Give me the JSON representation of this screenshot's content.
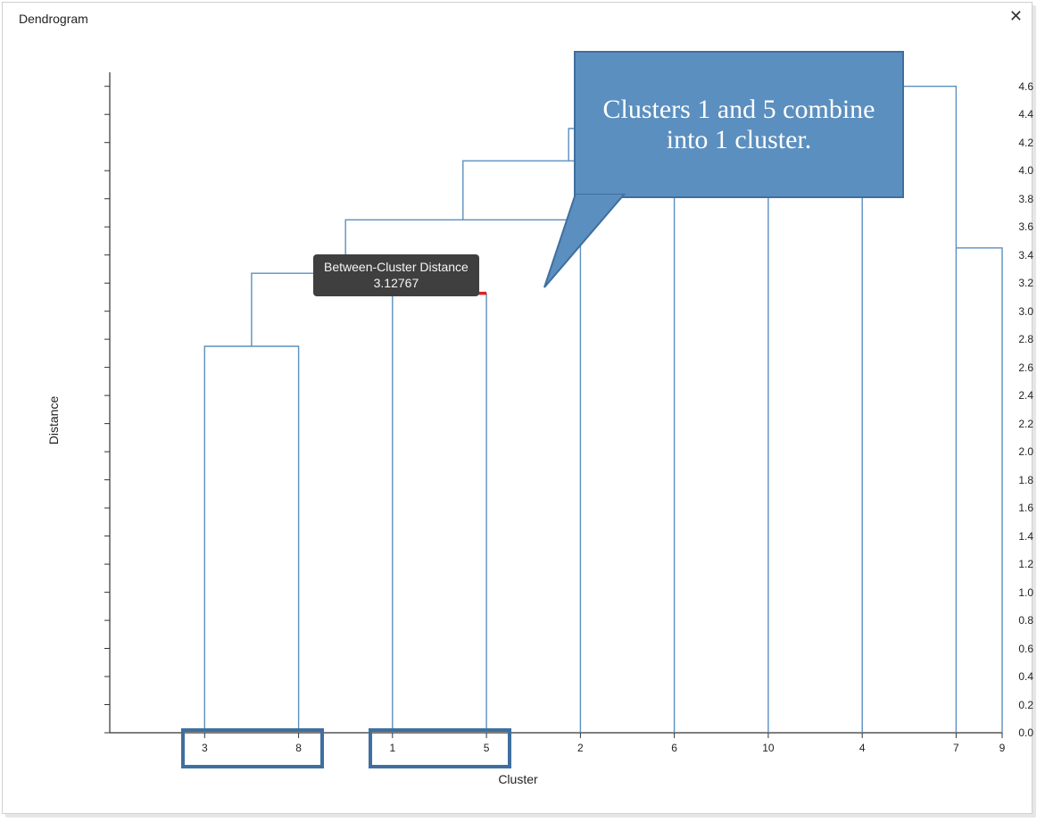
{
  "panel": {
    "title": "Dendrogram"
  },
  "axes": {
    "xlabel": "Cluster",
    "ylabel": "Distance"
  },
  "tooltip": {
    "label": "Between-Cluster Distance",
    "value": "3.12767"
  },
  "callout": {
    "text": "Clusters 1 and 5 combine into 1 cluster."
  },
  "chart_data": {
    "type": "dendrogram",
    "title": "Dendrogram",
    "xlabel": "Cluster",
    "ylabel": "Distance",
    "ylim": [
      0.0,
      4.7
    ],
    "y_ticks": [
      0.0,
      0.2,
      0.4,
      0.6,
      0.8,
      1.0,
      1.2,
      1.4,
      1.6,
      1.8,
      2.0,
      2.2,
      2.4,
      2.6,
      2.8,
      3.0,
      3.2,
      3.4,
      3.6,
      3.8,
      4.0,
      4.2,
      4.4,
      4.6
    ],
    "leaf_order": [
      "3",
      "8",
      "1",
      "5",
      "2",
      "6",
      "10",
      "4",
      "7",
      "9"
    ],
    "merges": [
      {
        "id": "m1",
        "left_leaf": "3",
        "right_leaf": "8",
        "height": 2.75
      },
      {
        "id": "m2",
        "left_leaf": "1",
        "right_leaf": "5",
        "height": 3.12767,
        "highlighted": true
      },
      {
        "id": "m3",
        "left": "m1",
        "right": "m2",
        "height": 3.27
      },
      {
        "id": "m4",
        "left": "m3",
        "right_leaf": "2",
        "height": 3.65
      },
      {
        "id": "m5",
        "left": "m4",
        "right_leaf": "6",
        "height": 4.07
      },
      {
        "id": "m6",
        "left": "m5",
        "right_leaf": "10",
        "height": 4.3
      },
      {
        "id": "m7",
        "left": "m6",
        "right_leaf": "4",
        "height": 4.37
      },
      {
        "id": "m8",
        "left": "m7",
        "right_leaf": "7",
        "height": 4.6
      },
      {
        "id": "m9",
        "left": "m8",
        "right_leaf": "9",
        "height": 3.45
      }
    ],
    "annotations": {
      "tooltip": {
        "label": "Between-Cluster Distance",
        "value": 3.12767
      },
      "callout": "Clusters 1 and 5 combine into 1 cluster.",
      "boxed_leaf_groups": [
        [
          "3",
          "8"
        ],
        [
          "1",
          "5"
        ]
      ]
    }
  }
}
